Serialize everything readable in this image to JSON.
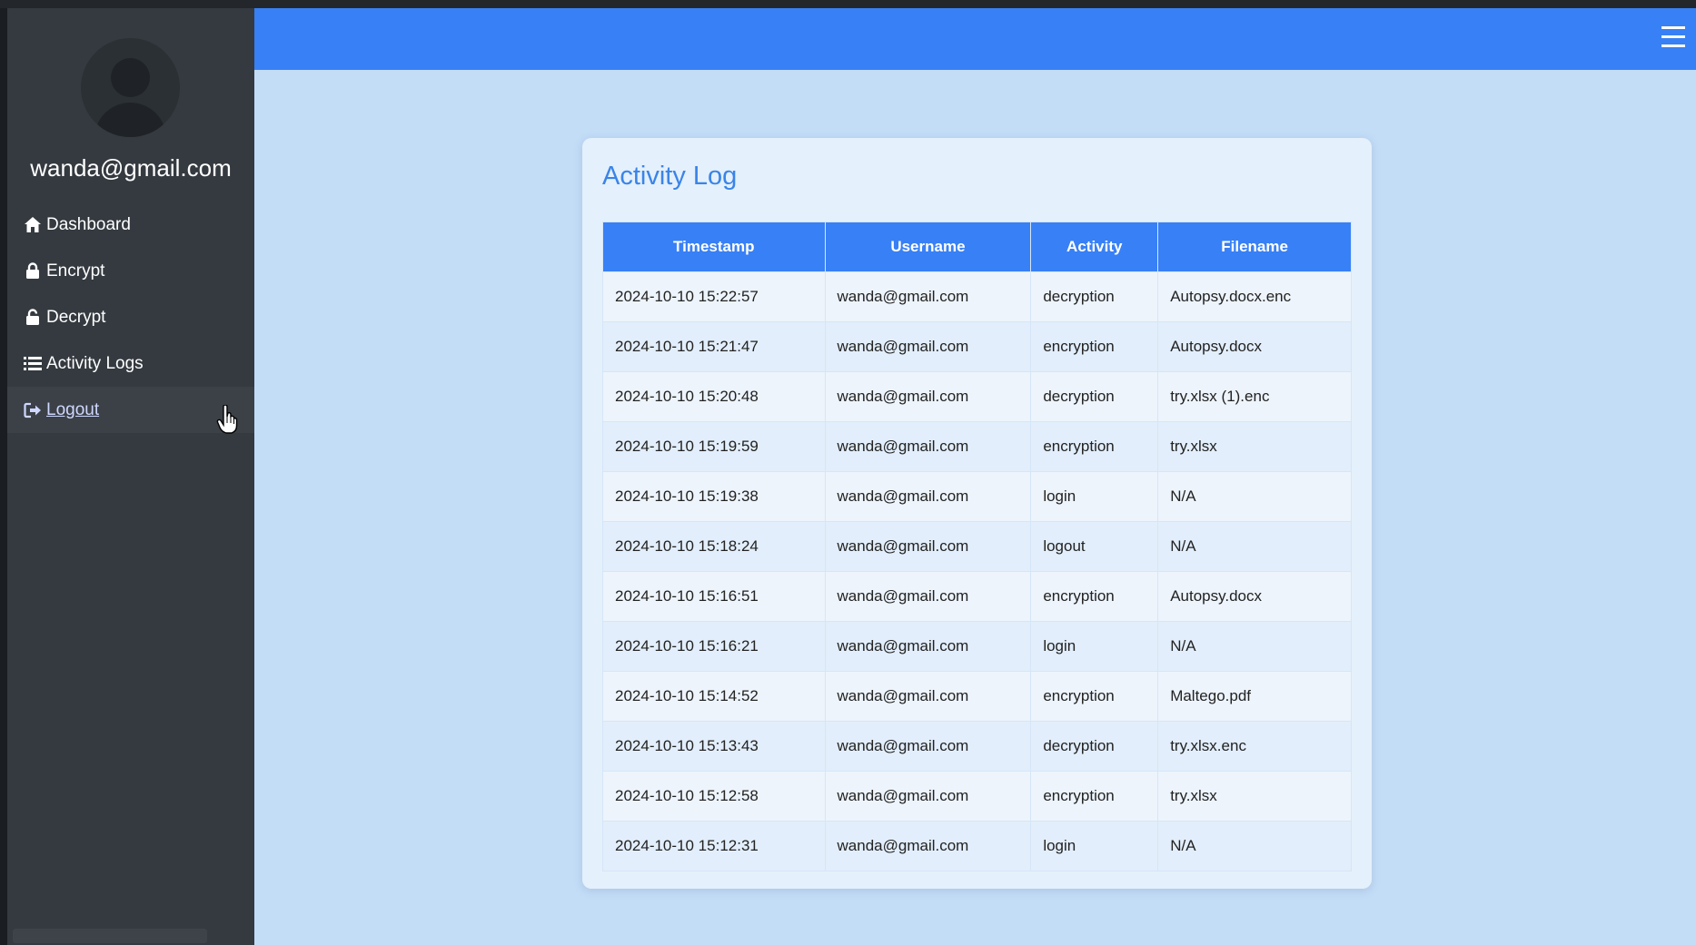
{
  "sidebar": {
    "user_email": "wanda@gmail.com",
    "items": [
      {
        "label": "Dashboard",
        "icon": "home-icon"
      },
      {
        "label": "Encrypt",
        "icon": "lock-icon"
      },
      {
        "label": "Decrypt",
        "icon": "unlock-icon"
      },
      {
        "label": "Activity Logs",
        "icon": "list-icon"
      },
      {
        "label": "Logout",
        "icon": "sign-out-icon"
      }
    ]
  },
  "topbar": {
    "menu_icon": "hamburger-menu-icon",
    "color": "#3880f5"
  },
  "main": {
    "title": "Activity Log",
    "columns": [
      "Timestamp",
      "Username",
      "Activity",
      "Filename"
    ],
    "rows": [
      [
        "2024-10-10 15:22:57",
        "wanda@gmail.com",
        "decryption",
        "Autopsy.docx.enc"
      ],
      [
        "2024-10-10 15:21:47",
        "wanda@gmail.com",
        "encryption",
        "Autopsy.docx"
      ],
      [
        "2024-10-10 15:20:48",
        "wanda@gmail.com",
        "decryption",
        "try.xlsx (1).enc"
      ],
      [
        "2024-10-10 15:19:59",
        "wanda@gmail.com",
        "encryption",
        "try.xlsx"
      ],
      [
        "2024-10-10 15:19:38",
        "wanda@gmail.com",
        "login",
        "N/A"
      ],
      [
        "2024-10-10 15:18:24",
        "wanda@gmail.com",
        "logout",
        "N/A"
      ],
      [
        "2024-10-10 15:16:51",
        "wanda@gmail.com",
        "encryption",
        "Autopsy.docx"
      ],
      [
        "2024-10-10 15:16:21",
        "wanda@gmail.com",
        "login",
        "N/A"
      ],
      [
        "2024-10-10 15:14:52",
        "wanda@gmail.com",
        "encryption",
        "Maltego.pdf"
      ],
      [
        "2024-10-10 15:13:43",
        "wanda@gmail.com",
        "decryption",
        "try.xlsx.enc"
      ],
      [
        "2024-10-10 15:12:58",
        "wanda@gmail.com",
        "encryption",
        "try.xlsx"
      ],
      [
        "2024-10-10 15:12:31",
        "wanda@gmail.com",
        "login",
        "N/A"
      ]
    ]
  },
  "colors": {
    "sidebar_bg": "#343a40",
    "main_bg": "#c3ddf7",
    "accent": "#3880f5",
    "title": "#3a84e8"
  }
}
